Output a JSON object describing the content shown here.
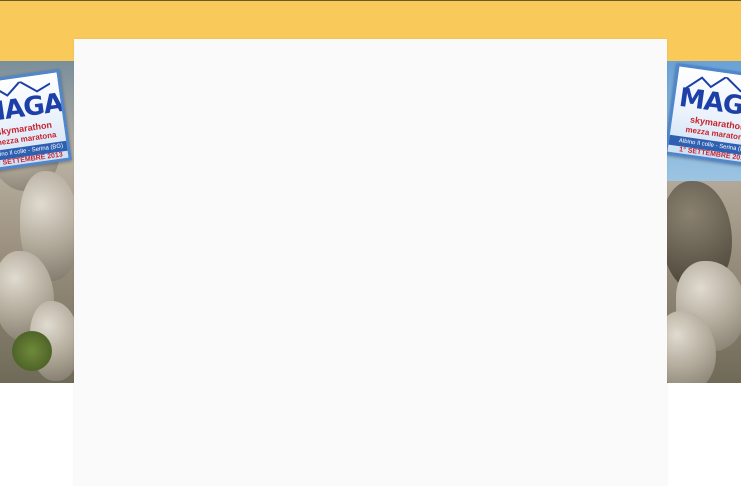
{
  "logo": {
    "brand": "MAGA",
    "subtitle": "skymarathon",
    "subtitle2": "mezza maratona",
    "place": "Albino Il colle - Serina (BG)",
    "date": "1° SETTEMBRE 2013"
  },
  "colors": {
    "header_bar": "#f9c95a",
    "content_panel": "#fafafa",
    "brand_text": "#1c3fa8",
    "accent_text": "#c8242d"
  }
}
